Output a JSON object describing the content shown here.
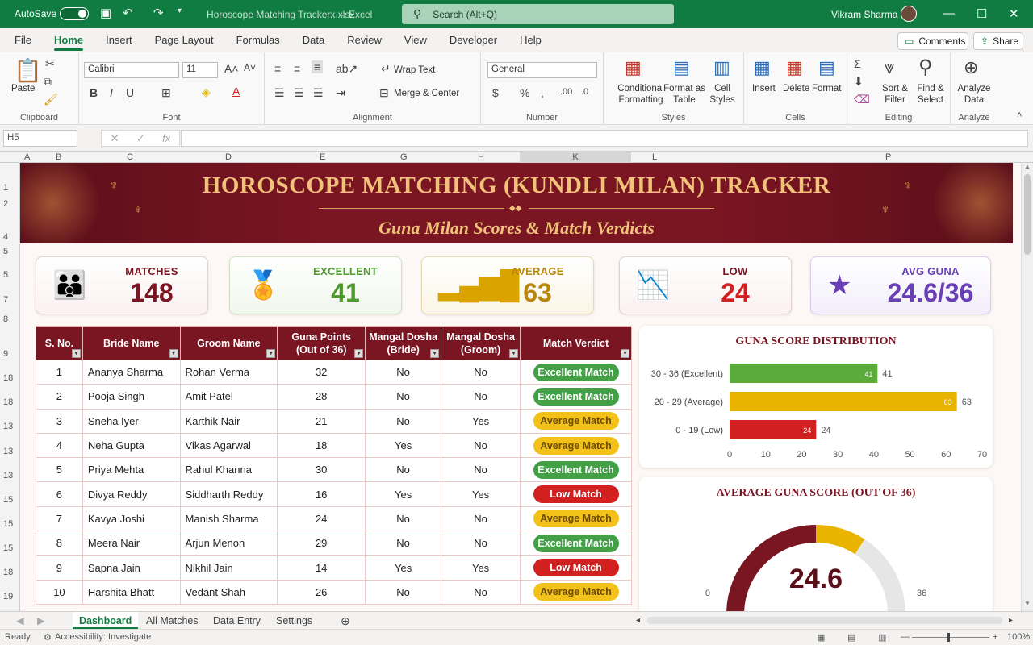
{
  "titlebar": {
    "autosave": "AutoSave",
    "filename": "Horoscope Matching Trackerx.xlsx",
    "app": "Excel",
    "search_placeholder": "Search (Alt+Q)",
    "user": "Vikram Sharma"
  },
  "menu": {
    "tabs": [
      "File",
      "Home",
      "Insert",
      "Page Layout",
      "Formulas",
      "Data",
      "Review",
      "View",
      "Developer",
      "Help"
    ],
    "active": "Home",
    "comments": "Comments",
    "share": "Share"
  },
  "ribbon": {
    "clipboard": {
      "paste": "Paste",
      "label": "Clipboard"
    },
    "font": {
      "name": "Calibri",
      "size": "11",
      "label": "Font"
    },
    "alignment": {
      "wrap": "Wrap Text",
      "merge": "Merge & Center",
      "label": "Alignment"
    },
    "number": {
      "format": "General",
      "label": "Number"
    },
    "styles": {
      "cond1": "Conditional",
      "cond2": "Formatting",
      "fmt1": "Format as",
      "fmt2": "Table",
      "cell1": "Cell",
      "cell2": "Styles",
      "label": "Styles"
    },
    "cells": {
      "insert": "Insert",
      "delete": "Delete",
      "format": "Format",
      "label": "Cells"
    },
    "editing": {
      "sort1": "Sort &",
      "sort2": "Filter",
      "find1": "Find &",
      "find2": "Select",
      "label": "Editing"
    },
    "analyze": {
      "a1": "Analyze",
      "a2": "Data",
      "label": "Analyze"
    }
  },
  "formula": {
    "namebox": "H5",
    "fx": "fx",
    "value": ""
  },
  "columns": [
    "A",
    "B",
    "C",
    "D",
    "E",
    "G",
    "H",
    "K",
    "L",
    "P"
  ],
  "rows": [
    "1",
    "2",
    "4",
    "5",
    "5",
    "7",
    "8",
    "9",
    "18",
    "18",
    "13",
    "13",
    "13",
    "15",
    "15",
    "15",
    "18",
    "19",
    "18"
  ],
  "banner": {
    "title": "HOROSCOPE MATCHING (KUNDLI MILAN) TRACKER",
    "subtitle": "Guna Milan Scores & Match Verdicts"
  },
  "kpis": [
    {
      "label": "MATCHES",
      "value": "148",
      "color": "#7a1522",
      "icon": "couple-icon"
    },
    {
      "label": "EXCELLENT",
      "value": "41",
      "color": "#4e9a2e",
      "icon": "award-icon"
    },
    {
      "label": "AVERAGE",
      "value": "63",
      "color": "#b8860b",
      "icon": "bar-chart-icon"
    },
    {
      "label": "LOW",
      "value": "24",
      "color": "#d21f1f",
      "icon": "down-trend-icon"
    },
    {
      "label": "AVG GUNA",
      "value": "24.6/36",
      "color": "#6a3fb5",
      "icon": "star-icon"
    }
  ],
  "table": {
    "headers": [
      "S. No.",
      "Bride Name",
      "Groom Name",
      "Guna Points (Out of 36)",
      "Mangal Dosha (Bride)",
      "Mangal Dosha (Groom)",
      "Match Verdict"
    ],
    "rows": [
      {
        "sno": "1",
        "bride": "Ananya Sharma",
        "groom": "Rohan Verma",
        "points": "32",
        "md_bride": "No",
        "md_groom": "No",
        "verdict": "Excellent Match"
      },
      {
        "sno": "2",
        "bride": "Pooja Singh",
        "groom": "Amit Patel",
        "points": "28",
        "md_bride": "No",
        "md_groom": "No",
        "verdict": "Excellent Match"
      },
      {
        "sno": "3",
        "bride": "Sneha Iyer",
        "groom": "Karthik Nair",
        "points": "21",
        "md_bride": "No",
        "md_groom": "Yes",
        "verdict": "Average Match"
      },
      {
        "sno": "4",
        "bride": "Neha Gupta",
        "groom": "Vikas Agarwal",
        "points": "18",
        "md_bride": "Yes",
        "md_groom": "No",
        "verdict": "Average Match"
      },
      {
        "sno": "5",
        "bride": "Priya Mehta",
        "groom": "Rahul Khanna",
        "points": "30",
        "md_bride": "No",
        "md_groom": "No",
        "verdict": "Excellent Match"
      },
      {
        "sno": "6",
        "bride": "Divya Reddy",
        "groom": "Siddharth Reddy",
        "points": "16",
        "md_bride": "Yes",
        "md_groom": "Yes",
        "verdict": "Low Match"
      },
      {
        "sno": "7",
        "bride": "Kavya Joshi",
        "groom": "Manish Sharma",
        "points": "24",
        "md_bride": "No",
        "md_groom": "No",
        "verdict": "Average Match"
      },
      {
        "sno": "8",
        "bride": "Meera Nair",
        "groom": "Arjun Menon",
        "points": "29",
        "md_bride": "No",
        "md_groom": "No",
        "verdict": "Excellent Match"
      },
      {
        "sno": "9",
        "bride": "Sapna Jain",
        "groom": "Nikhil Jain",
        "points": "14",
        "md_bride": "Yes",
        "md_groom": "Yes",
        "verdict": "Low Match"
      },
      {
        "sno": "10",
        "bride": "Harshita Bhatt",
        "groom": "Vedant Shah",
        "points": "26",
        "md_bride": "No",
        "md_groom": "No",
        "verdict": "Average Match"
      }
    ]
  },
  "chart_data": [
    {
      "type": "bar",
      "orientation": "horizontal",
      "title": "GUNA SCORE DISTRIBUTION",
      "categories": [
        "30 - 36 (Excellent)",
        "20 - 29 (Average)",
        "0 - 19 (Low)"
      ],
      "values": [
        41,
        63,
        24
      ],
      "colors": [
        "#5aab3a",
        "#e8b400",
        "#d21f1f"
      ],
      "xlim": [
        0,
        70
      ],
      "xticks": [
        0,
        10,
        20,
        30,
        40,
        50,
        60,
        70
      ]
    },
    {
      "type": "gauge",
      "title": "AVERAGE GUNA SCORE (OUT OF 36)",
      "value": 24.6,
      "min": 0,
      "max": 36,
      "value_label": "24.6",
      "min_label": "0",
      "max_label": "36"
    }
  ],
  "sheets": [
    "Dashboard",
    "All Matches",
    "Data Entry",
    "Settings"
  ],
  "status": {
    "ready": "Ready",
    "accessibility": "Accessibility: Investigate",
    "zoom": "100%"
  }
}
